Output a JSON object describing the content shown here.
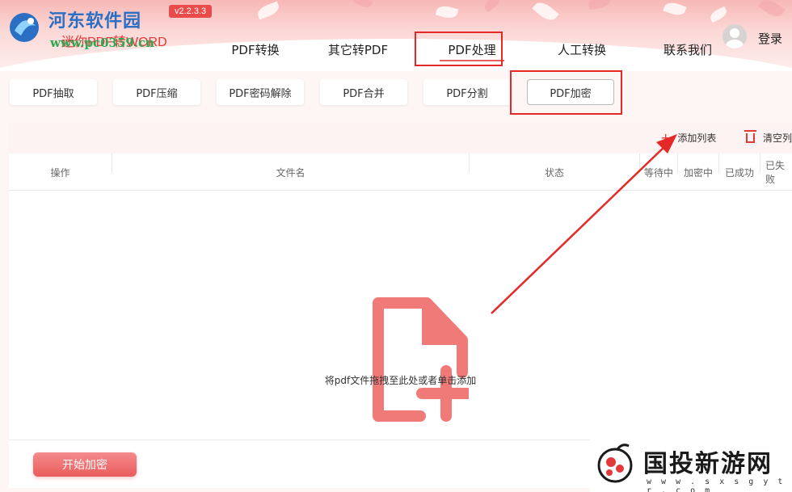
{
  "brand": {
    "site_name": "河东软件园",
    "site_url": "www.pc0359.cn",
    "version": "v2.2.3.3",
    "app_name": "迷你PDF转WORD"
  },
  "nav": {
    "tabs": [
      {
        "label": "PDF转换",
        "active": false
      },
      {
        "label": "其它转PDF",
        "active": false
      },
      {
        "label": "PDF处理",
        "active": true
      },
      {
        "label": "人工转换",
        "active": false
      },
      {
        "label": "联系我们",
        "active": false
      }
    ],
    "login_label": "登录"
  },
  "subtabs": [
    {
      "label": "PDF抽取",
      "active": false
    },
    {
      "label": "PDF压缩",
      "active": false
    },
    {
      "label": "PDF密码解除",
      "active": false
    },
    {
      "label": "PDF合并",
      "active": false
    },
    {
      "label": "PDF分割",
      "active": false
    },
    {
      "label": "PDF加密",
      "active": true
    }
  ],
  "toolbar": {
    "add_label": "添加列表",
    "clear_label": "清空列"
  },
  "table": {
    "headers": {
      "action": "操作",
      "filename": "文件名",
      "status": "状态",
      "waiting": "等待中",
      "encrypting": "加密中",
      "success": "已成功",
      "failed": "已失败"
    }
  },
  "dropzone": {
    "hint": "将pdf文件拖拽至此处或者单击添加"
  },
  "start_button": "开始加密",
  "watermark": {
    "name": "国投新游网",
    "url": "w w w . s x s g y t r . c o m"
  },
  "colors": {
    "accent": "#e23a3a",
    "highlight_border": "#e52828",
    "file_icon": "#f07a78",
    "start_button": "#ea5c5c"
  }
}
